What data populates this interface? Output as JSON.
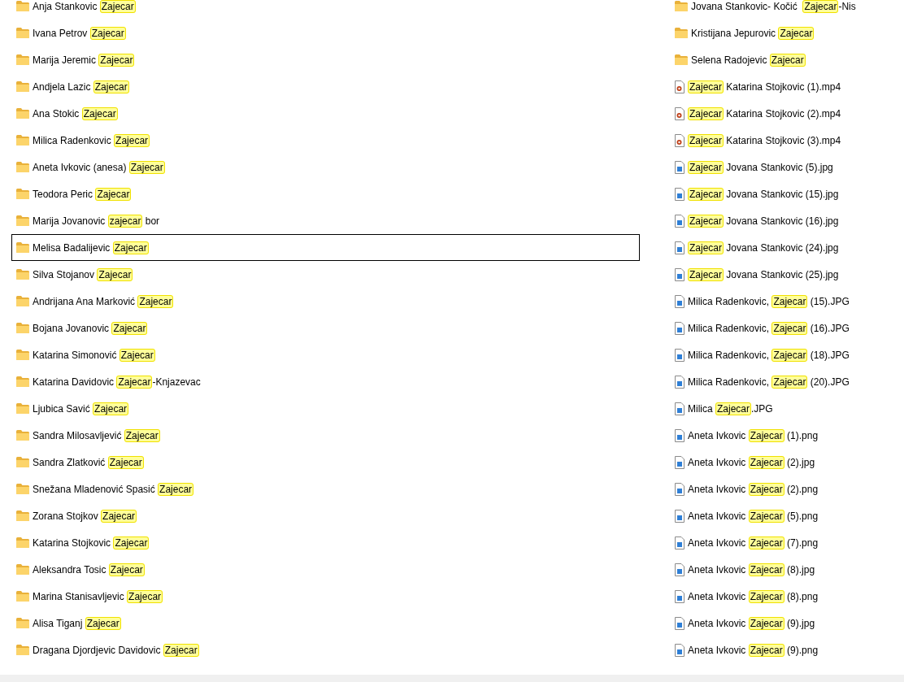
{
  "columns": [
    {
      "items": [
        {
          "kind": "folder",
          "selected": false,
          "prefix": "Anja Stankovic ",
          "match": "Zajecar"
        },
        {
          "kind": "folder",
          "selected": false,
          "prefix": "Ivana Petrov ",
          "match": "Zajecar"
        },
        {
          "kind": "folder",
          "selected": false,
          "prefix": "Marija Jeremic ",
          "match": "Zajecar"
        },
        {
          "kind": "folder",
          "selected": false,
          "prefix": "Andjela Lazic ",
          "match": "Zajecar"
        },
        {
          "kind": "folder",
          "selected": false,
          "prefix": "Ana Stokic ",
          "match": "Zajecar"
        },
        {
          "kind": "folder",
          "selected": false,
          "prefix": "Milica Radenkovic ",
          "match": "Zajecar"
        },
        {
          "kind": "folder",
          "selected": false,
          "prefix": "Aneta Ivkovic (anesa) ",
          "match": "Zajecar"
        },
        {
          "kind": "folder",
          "selected": false,
          "prefix": "Teodora Peric ",
          "match": "Zajecar"
        },
        {
          "kind": "folder",
          "selected": false,
          "prefix": "Marija Jovanovic ",
          "match": "zajecar",
          "suffix": " bor"
        },
        {
          "kind": "folder",
          "selected": true,
          "prefix": "Melisa Badalijevic ",
          "match": "Zajecar"
        },
        {
          "kind": "folder",
          "selected": false,
          "prefix": "Silva Stojanov ",
          "match": "Zajecar"
        },
        {
          "kind": "folder",
          "selected": false,
          "prefix": "Andrijana Ana Marković ",
          "match": "Zajecar"
        },
        {
          "kind": "folder",
          "selected": false,
          "prefix": "Bojana Jovanovic ",
          "match": "Zajecar"
        },
        {
          "kind": "folder",
          "selected": false,
          "prefix": "Katarina Simonović ",
          "match": "Zajecar"
        },
        {
          "kind": "folder",
          "selected": false,
          "prefix": "Katarina Davidovic ",
          "match": "Zajecar",
          "suffix": "-Knjazevac"
        },
        {
          "kind": "folder",
          "selected": false,
          "prefix": "Ljubica Savić ",
          "match": "Zajecar"
        },
        {
          "kind": "folder",
          "selected": false,
          "prefix": "Sandra Milosavljević ",
          "match": "Zajecar"
        },
        {
          "kind": "folder",
          "selected": false,
          "prefix": "Sandra Zlatković ",
          "match": "Zajecar"
        },
        {
          "kind": "folder",
          "selected": false,
          "prefix": "Snežana Mladenović Spasić ",
          "match": "Zajecar"
        },
        {
          "kind": "folder",
          "selected": false,
          "prefix": "Zorana Stojkov ",
          "match": "Zajecar"
        },
        {
          "kind": "folder",
          "selected": false,
          "prefix": "Katarina Stojkovic ",
          "match": "Zajecar"
        },
        {
          "kind": "folder",
          "selected": false,
          "prefix": "Aleksandra Tosic ",
          "match": "Zajecar"
        },
        {
          "kind": "folder",
          "selected": false,
          "prefix": "Marina Stanisavljevic ",
          "match": "Zajecar"
        },
        {
          "kind": "folder",
          "selected": false,
          "prefix": "Alisa Tiganj ",
          "match": "Zajecar"
        },
        {
          "kind": "folder",
          "selected": false,
          "prefix": "Dragana Djordjevic Davidovic ",
          "match": "Zajecar"
        }
      ]
    },
    {
      "items": [
        {
          "kind": "folder",
          "selected": false,
          "prefix": "Jovana Stankovic- Kočić  ",
          "match": "Zajecar",
          "suffix": "-Nis"
        },
        {
          "kind": "folder",
          "selected": false,
          "prefix": "Kristijana Jepurovic ",
          "match": "Zajecar"
        },
        {
          "kind": "folder",
          "selected": false,
          "prefix": "Selena Radojevic ",
          "match": "Zajecar"
        },
        {
          "kind": "video",
          "selected": false,
          "match": "Zajecar",
          "suffix": " Katarina Stojkovic (1).mp4"
        },
        {
          "kind": "video",
          "selected": false,
          "match": "Zajecar",
          "suffix": " Katarina Stojkovic (2).mp4"
        },
        {
          "kind": "video",
          "selected": false,
          "match": "Zajecar",
          "suffix": " Katarina Stojkovic (3).mp4"
        },
        {
          "kind": "image",
          "selected": false,
          "match": "Zajecar",
          "suffix": " Jovana Stankovic (5).jpg"
        },
        {
          "kind": "image",
          "selected": false,
          "match": "Zajecar",
          "suffix": " Jovana Stankovic (15).jpg"
        },
        {
          "kind": "image",
          "selected": false,
          "match": "Zajecar",
          "suffix": " Jovana Stankovic (16).jpg"
        },
        {
          "kind": "image",
          "selected": false,
          "match": "Zajecar",
          "suffix": " Jovana Stankovic (24).jpg"
        },
        {
          "kind": "image",
          "selected": false,
          "match": "Zajecar",
          "suffix": " Jovana Stankovic (25).jpg"
        },
        {
          "kind": "image",
          "selected": false,
          "prefix": "Milica Radenkovic, ",
          "match": "Zajecar",
          "suffix": " (15).JPG"
        },
        {
          "kind": "image",
          "selected": false,
          "prefix": "Milica Radenkovic, ",
          "match": "Zajecar",
          "suffix": " (16).JPG"
        },
        {
          "kind": "image",
          "selected": false,
          "prefix": "Milica Radenkovic, ",
          "match": "Zajecar",
          "suffix": " (18).JPG"
        },
        {
          "kind": "image",
          "selected": false,
          "prefix": "Milica Radenkovic, ",
          "match": "Zajecar",
          "suffix": " (20).JPG"
        },
        {
          "kind": "image",
          "selected": false,
          "prefix": "Milica ",
          "match": "Zajecar",
          "suffix": ".JPG"
        },
        {
          "kind": "image",
          "selected": false,
          "prefix": "Aneta Ivkovic ",
          "match": "Zajecar",
          "suffix": " (1).png"
        },
        {
          "kind": "image",
          "selected": false,
          "prefix": "Aneta Ivkovic ",
          "match": "Zajecar",
          "suffix": " (2).jpg"
        },
        {
          "kind": "image",
          "selected": false,
          "prefix": "Aneta Ivkovic ",
          "match": "Zajecar",
          "suffix": " (2).png"
        },
        {
          "kind": "image",
          "selected": false,
          "prefix": "Aneta Ivkovic ",
          "match": "Zajecar",
          "suffix": " (5).png"
        },
        {
          "kind": "image",
          "selected": false,
          "prefix": "Aneta Ivkovic ",
          "match": "Zajecar",
          "suffix": " (7).png"
        },
        {
          "kind": "image",
          "selected": false,
          "prefix": "Aneta Ivkovic ",
          "match": "Zajecar",
          "suffix": " (8).jpg"
        },
        {
          "kind": "image",
          "selected": false,
          "prefix": "Aneta Ivkovic ",
          "match": "Zajecar",
          "suffix": " (8).png"
        },
        {
          "kind": "image",
          "selected": false,
          "prefix": "Aneta Ivkovic ",
          "match": "Zajecar",
          "suffix": " (9).jpg"
        },
        {
          "kind": "image",
          "selected": false,
          "prefix": "Aneta Ivkovic ",
          "match": "Zajecar",
          "suffix": " (9).png"
        }
      ]
    }
  ]
}
